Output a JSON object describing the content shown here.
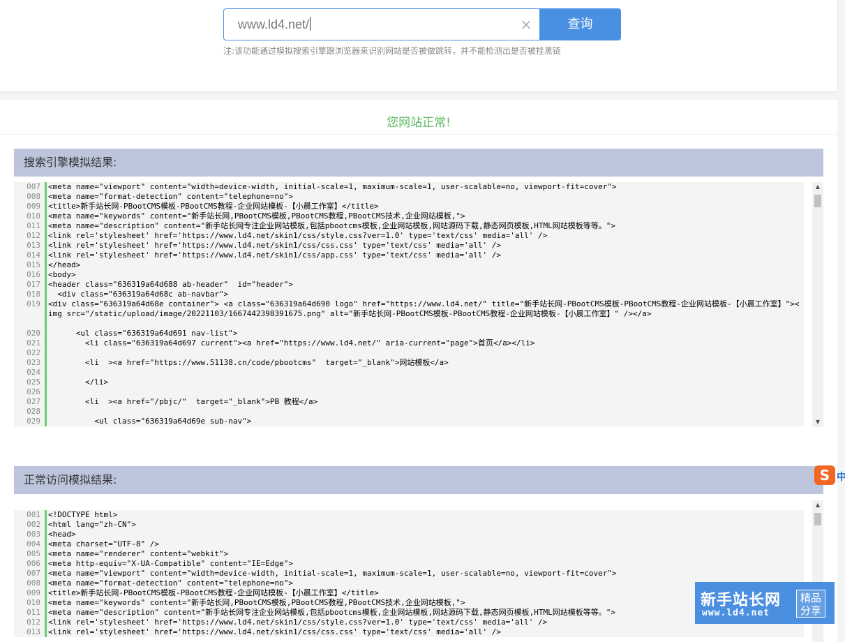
{
  "search": {
    "value": "www.ld4.net/",
    "button_label": "查询",
    "clear_icon": "close-icon",
    "note": "注:该功能通过模拟搜索引擎跟浏览器来识别网站是否被做跳转，并不能检测出是否被挂黑链"
  },
  "status": {
    "message": "您网站正常!",
    "color": "#5cb85c"
  },
  "colors": {
    "accent": "#4a90e2",
    "section_header": "#bcc5dc",
    "gutter": "#6ccc6c"
  },
  "engine_section": {
    "title": "搜索引擎模拟结果:",
    "lines": [
      {
        "n": "007",
        "text": "<meta name=\"viewport\" content=\"width=device-width, initial-scale=1, maximum-scale=1, user-scalable=no, viewport-fit=cover\">"
      },
      {
        "n": "008",
        "text": "<meta name=\"format-detection\" content=\"telephone=no\">"
      },
      {
        "n": "009",
        "text": "<title>新手站长网-PBootCMS模板-PBootCMS教程-企业网站模板-【小晨工作室】</title>"
      },
      {
        "n": "010",
        "text": "<meta name=\"keywords\" content=\"新手站长网,PBootCMS模板,PBootCMS教程,PBootCMS技术,企业网站模板,\">"
      },
      {
        "n": "011",
        "text": "<meta name=\"description\" content=\"新手站长网专注企业网站模板,包括pbootcms模板,企业网站模板,网站源码下载,静态网页模板,HTML网站模板等等。\">"
      },
      {
        "n": "012",
        "text": "<link rel='stylesheet' href='https://www.ld4.net/skin1/css/style.css?ver=1.0' type='text/css' media='all' />"
      },
      {
        "n": "013",
        "text": "<link rel='stylesheet' href='https://www.ld4.net/skin1/css/css.css' type='text/css' media='all' />"
      },
      {
        "n": "014",
        "text": "<link rel='stylesheet' href='https://www.ld4.net/skin1/css/app.css' type='text/css' media='all' />"
      },
      {
        "n": "015",
        "text": "</head>"
      },
      {
        "n": "016",
        "text": "<body>"
      },
      {
        "n": "017",
        "text": "<header class=\"636319a64d688 ab-header\"  id=\"header\">"
      },
      {
        "n": "018",
        "text": "  <div class=\"636319a64d68c ab-navbar\">"
      },
      {
        "n": "019",
        "text": "    <div class=\"636319a64d68e container\"> <a class=\"636319a64d690 logo\" href=\"https://www.ld4.net/\" title=\"新手站长网-PBootCMS模板-PBootCMS教程-企业网站模板-【小晨工作室】\"><img src=\"/static/upload/image/20221103/1667442398391675.png\" alt=\"新手站长网-PBootCMS模板-PBootCMS教程-企业网站模板-【小晨工作室】\" /></a>"
      },
      {
        "n": "020",
        "text": "      <ul class=\"636319a64d691 nav-list\">"
      },
      {
        "n": "021",
        "text": "        <li class=\"636319a64d697 current\"><a href=\"https://www.ld4.net/\" aria-current=\"page\">首页</a></li>"
      },
      {
        "n": "022",
        "text": ""
      },
      {
        "n": "023",
        "text": "        <li  ><a href=\"https://www.51138.cn/code/pbootcms\"  target=\"_blank\">网站模板</a>"
      },
      {
        "n": "024",
        "text": ""
      },
      {
        "n": "025",
        "text": "        </li>"
      },
      {
        "n": "026",
        "text": ""
      },
      {
        "n": "027",
        "text": "        <li  ><a href=\"/pbjc/\"  target=\"_blank\">PB 教程</a>"
      },
      {
        "n": "028",
        "text": ""
      },
      {
        "n": "029",
        "text": "          <ul class=\"636319a64d69e sub-nav\">"
      }
    ]
  },
  "normal_section": {
    "title": "正常访问模拟结果:",
    "lines": [
      {
        "n": "001",
        "text": "<!DOCTYPE html>"
      },
      {
        "n": "002",
        "text": "<html lang=\"zh-CN\">"
      },
      {
        "n": "003",
        "text": "<head>"
      },
      {
        "n": "004",
        "text": "<meta charset=\"UTF-8\" />"
      },
      {
        "n": "005",
        "text": "<meta name=\"renderer\" content=\"webkit\">"
      },
      {
        "n": "006",
        "text": "<meta http-equiv=\"X-UA-Compatible\" content=\"IE=Edge\">"
      },
      {
        "n": "007",
        "text": "<meta name=\"viewport\" content=\"width=device-width, initial-scale=1, maximum-scale=1, user-scalable=no, viewport-fit=cover\">"
      },
      {
        "n": "008",
        "text": "<meta name=\"format-detection\" content=\"telephone=no\">"
      },
      {
        "n": "009",
        "text": "<title>新手站长网-PBootCMS模板-PBootCMS教程-企业网站模板-【小晨工作室】</title>"
      },
      {
        "n": "010",
        "text": "<meta name=\"keywords\" content=\"新手站长网,PBootCMS模板,PBootCMS教程,PBootCMS技术,企业网站模板,\">"
      },
      {
        "n": "011",
        "text": "<meta name=\"description\" content=\"新手站长网专注企业网站模板,包括pbootcms模板,企业网站模板,网站源码下载,静态网页模板,HTML网站模板等等。\">"
      },
      {
        "n": "012",
        "text": "<link rel='stylesheet' href='https://www.ld4.net/skin1/css/style.css?ver=1.0' type='text/css' media='all' />"
      },
      {
        "n": "013",
        "text": "<link rel='stylesheet' href='https://www.ld4.net/skin1/css/css.css' type='text/css' media='all' />"
      }
    ]
  },
  "overlay": {
    "sogou_icon": "sogou-icon",
    "sogou_icon_letter": "S",
    "sogou_label": "中",
    "badge_title": "新手站长网",
    "badge_url": "www.ld4.net",
    "badge_tag": "精品分享"
  }
}
